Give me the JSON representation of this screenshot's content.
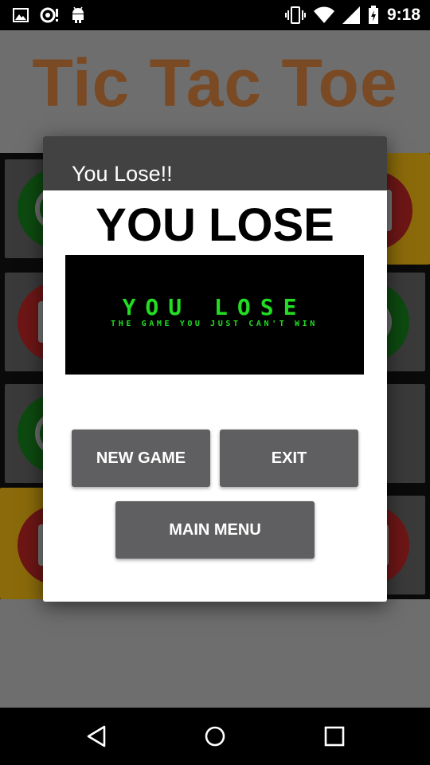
{
  "status_bar": {
    "time": "9:18",
    "left_icons": [
      "image-icon",
      "sync-alert-icon",
      "android-icon"
    ],
    "right_icons": [
      "vibrate-icon",
      "wifi-icon",
      "signal-icon",
      "battery-charging-icon"
    ]
  },
  "app": {
    "title": "Tic Tac Toe",
    "title_color": "#7a4a24"
  },
  "dialog": {
    "title": "You Lose!!",
    "heading": "YOU LOSE",
    "image_text": {
      "main": "YOU LOSE",
      "sub": "THE GAME YOU JUST CAN'T WIN"
    },
    "buttons": {
      "new_game": "NEW GAME",
      "exit": "EXIT",
      "main_menu": "MAIN MENU"
    }
  },
  "nav_bar": {
    "icons": [
      "back-icon",
      "home-icon",
      "recents-icon"
    ]
  },
  "colors": {
    "dialog_header": "#424242",
    "button": "#5f5f61",
    "image_text": "#22dd22"
  }
}
